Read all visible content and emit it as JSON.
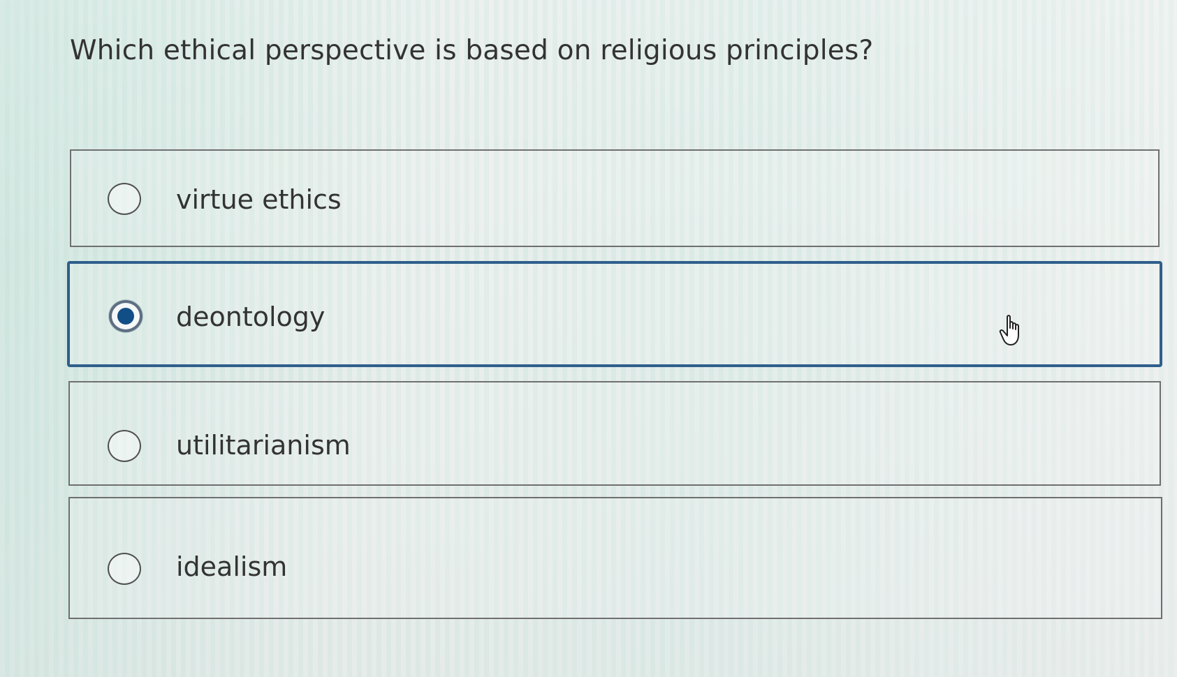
{
  "quiz": {
    "question": "Which ethical perspective is based on religious principles?",
    "options": [
      {
        "label": "virtue ethics",
        "selected": false
      },
      {
        "label": "deontology",
        "selected": true
      },
      {
        "label": "utilitarianism",
        "selected": false
      },
      {
        "label": "idealism",
        "selected": false
      }
    ]
  },
  "cursor": {
    "icon": "hand-pointer-icon"
  },
  "colors": {
    "selected_border": "#2f5f8c",
    "radio_fill": "#124e86",
    "border": "#6f6f6f",
    "text": "#333333"
  }
}
